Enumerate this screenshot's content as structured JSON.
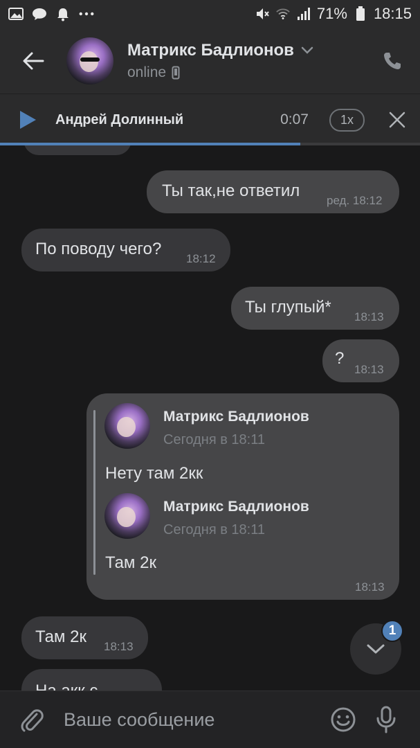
{
  "status_bar": {
    "battery": "71%",
    "time": "18:15"
  },
  "header": {
    "name": "Матрикс Бадлионов",
    "status": "online"
  },
  "player": {
    "title": "Андрей Долинный",
    "time": "0:07",
    "speed": "1x",
    "progress": 0.715
  },
  "messages": [
    {
      "direction": "out",
      "text": "Ты так,не ответил",
      "time": "ред. 18:12"
    },
    {
      "direction": "in",
      "text": "По поводу чего?",
      "time": "18:12"
    },
    {
      "direction": "out",
      "text": "Ты глупый*",
      "time": "18:13"
    },
    {
      "direction": "out",
      "text": "?",
      "time": "18:13"
    },
    {
      "direction": "in",
      "text": "Там 2к",
      "time": "18:13"
    },
    {
      "direction": "in",
      "text": "На акк с",
      "time": ""
    }
  ],
  "forwarded": {
    "time": "18:13",
    "items": [
      {
        "author": "Матрикс Бадлионов",
        "date": "Сегодня в 18:11",
        "text": "Нету там 2кк"
      },
      {
        "author": "Матрикс Бадлионов",
        "date": "Сегодня в 18:11",
        "text": "Там 2к"
      }
    ]
  },
  "scroll_badge": "1",
  "composer": {
    "placeholder": "Ваше сообщение"
  },
  "colors": {
    "accent": "#5181b8",
    "background": "#19191a",
    "bubble_in": "#37373a",
    "bubble_out": "#464648"
  }
}
